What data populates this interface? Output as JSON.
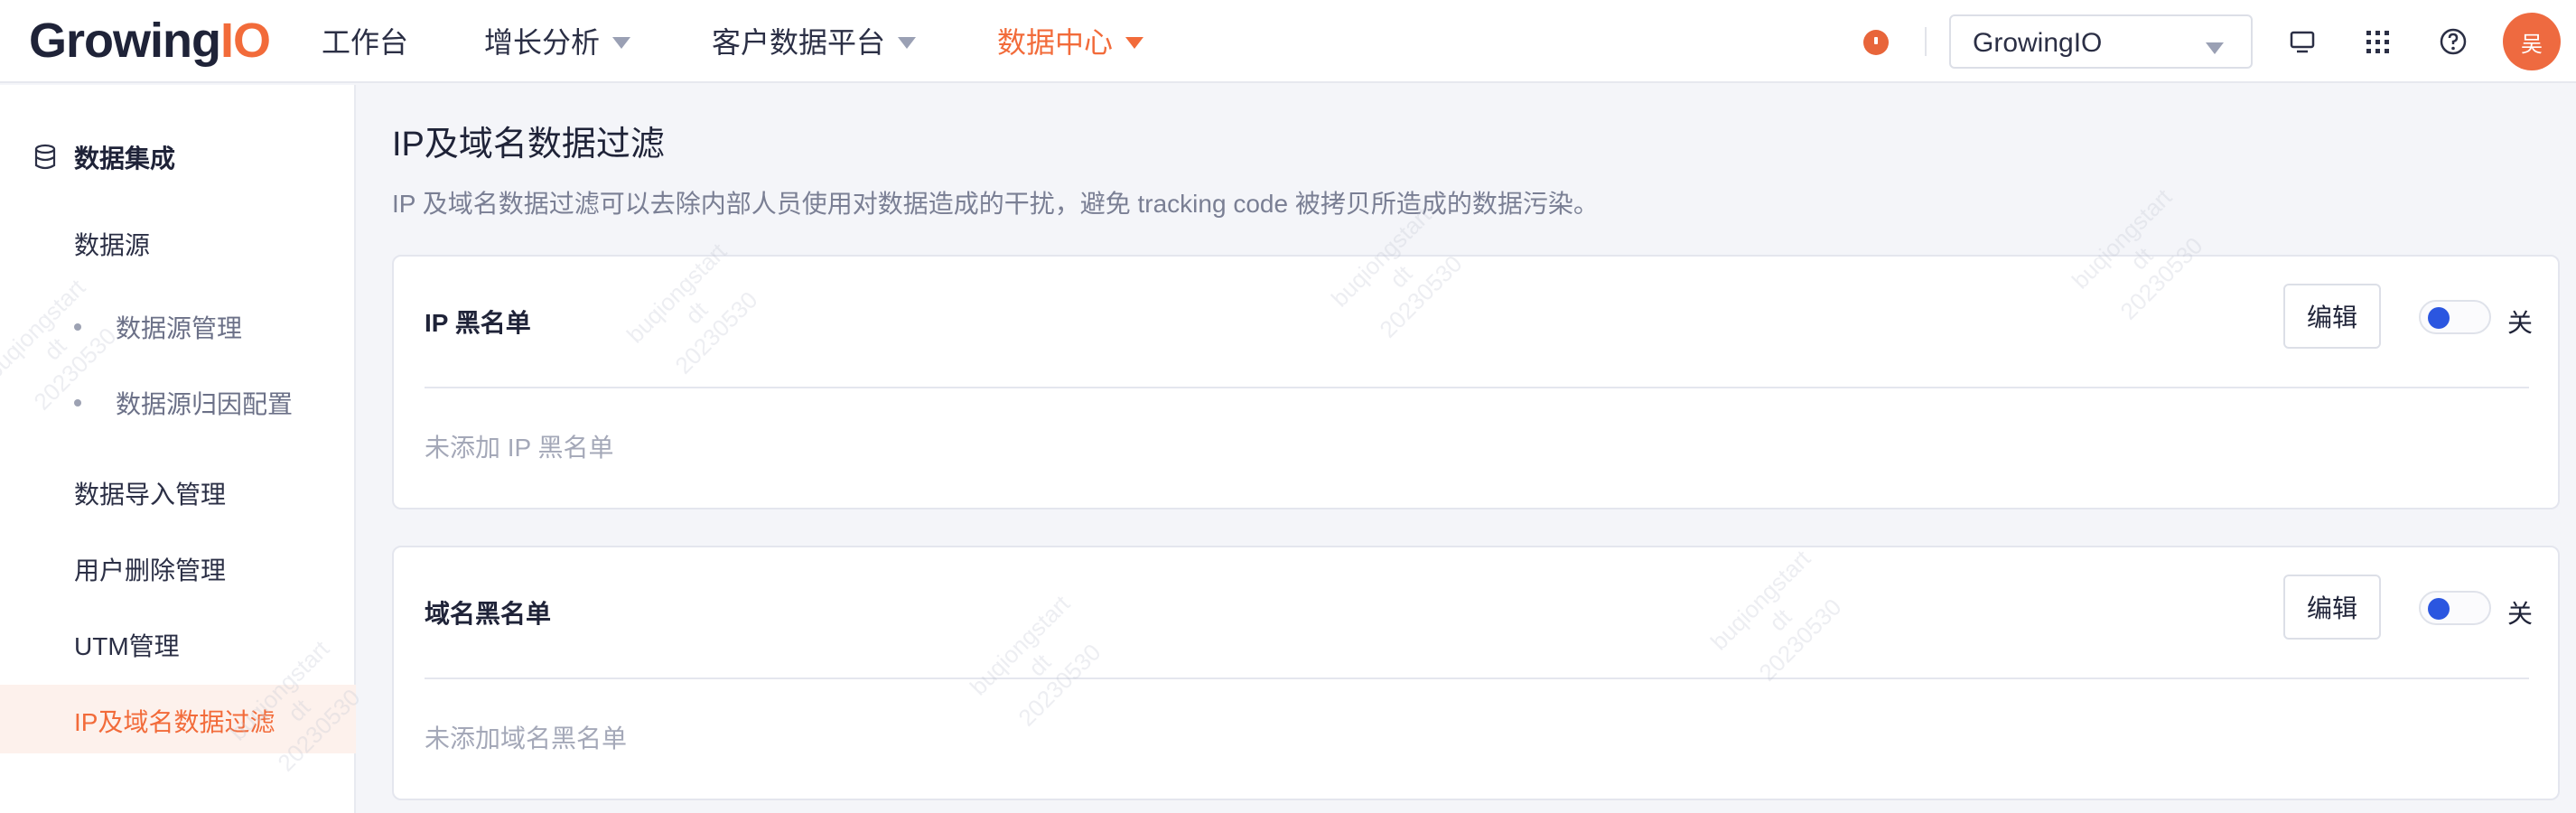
{
  "header": {
    "logo": {
      "main": "Growing",
      "accent": "IO"
    },
    "nav": [
      {
        "label": "工作台",
        "has_caret": false,
        "active": false
      },
      {
        "label": "增长分析",
        "has_caret": true,
        "active": false
      },
      {
        "label": "客户数据平台",
        "has_caret": true,
        "active": false
      },
      {
        "label": "数据中心",
        "has_caret": true,
        "active": true
      }
    ],
    "project_select": {
      "value": "GrowingIO"
    },
    "icons": [
      "notification-icon",
      "monitor-icon",
      "apps-grid-icon",
      "help-icon"
    ],
    "avatar_text": "吴"
  },
  "sidebar": {
    "section_label": "数据集成",
    "items": [
      {
        "label": "数据源",
        "type": "item"
      },
      {
        "label": "数据源管理",
        "type": "sub"
      },
      {
        "label": "数据源归因配置",
        "type": "sub"
      },
      {
        "label": "数据导入管理",
        "type": "item"
      },
      {
        "label": "用户删除管理",
        "type": "item"
      },
      {
        "label": "UTM管理",
        "type": "item"
      },
      {
        "label": "IP及域名数据过滤",
        "type": "item",
        "active": true
      }
    ]
  },
  "main": {
    "title": "IP及域名数据过滤",
    "description": "IP 及域名数据过滤可以去除内部人员使用对数据造成的干扰，避免 tracking code 被拷贝所造成的数据污染。",
    "cards": [
      {
        "title": "IP 黑名单",
        "edit_label": "编辑",
        "toggle_label": "关",
        "toggle_on": false,
        "empty_text": "未添加 IP 黑名单"
      },
      {
        "title": "域名黑名单",
        "edit_label": "编辑",
        "toggle_label": "关",
        "toggle_on": false,
        "empty_text": "未添加域名黑名单"
      }
    ]
  },
  "watermark": {
    "line1": "buqiongstart",
    "line2": "dt",
    "line3": "20230530"
  },
  "colors": {
    "accent": "#f26b3a",
    "toggle_knob": "#2b56e0",
    "active_bg": "#fdf1ec"
  }
}
